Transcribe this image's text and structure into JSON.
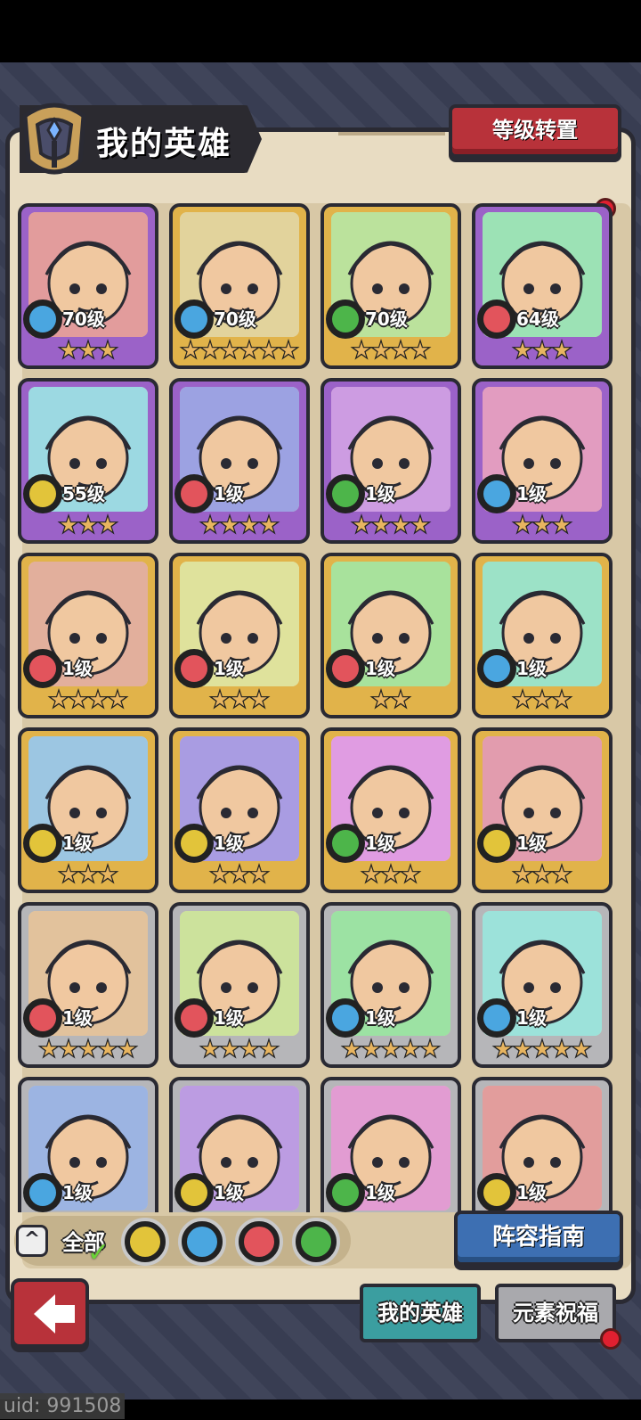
{
  "header": {
    "title": "我的英雄",
    "level_transfer_label": "等级转置"
  },
  "colors": {
    "water": "#4aa6e0",
    "fire": "#e2545c",
    "wind": "#4db54a",
    "earth": "#e2c43a",
    "card_purple": "#9b62c8",
    "card_gold": "#e1b34a",
    "card_silver": "#b6b6b9"
  },
  "heroes": [
    {
      "level": "70级",
      "element": "water",
      "frame": "purple",
      "stars": 3
    },
    {
      "level": "70级",
      "element": "water",
      "frame": "gold",
      "stars": 6
    },
    {
      "level": "70级",
      "element": "wind",
      "frame": "gold",
      "stars": 4
    },
    {
      "level": "64级",
      "element": "fire",
      "frame": "purple",
      "stars": 3
    },
    {
      "level": "55级",
      "element": "earth",
      "frame": "purple",
      "stars": 3
    },
    {
      "level": "1级",
      "element": "fire",
      "frame": "purple",
      "stars": 4
    },
    {
      "level": "1级",
      "element": "wind",
      "frame": "purple",
      "stars": 4
    },
    {
      "level": "1级",
      "element": "water",
      "frame": "purple",
      "stars": 3
    },
    {
      "level": "1级",
      "element": "fire",
      "frame": "gold",
      "stars": 4
    },
    {
      "level": "1级",
      "element": "fire",
      "frame": "gold",
      "stars": 3
    },
    {
      "level": "1级",
      "element": "fire",
      "frame": "gold",
      "stars": 2
    },
    {
      "level": "1级",
      "element": "water",
      "frame": "gold",
      "stars": 3
    },
    {
      "level": "1级",
      "element": "earth",
      "frame": "gold",
      "stars": 3
    },
    {
      "level": "1级",
      "element": "earth",
      "frame": "gold",
      "stars": 3
    },
    {
      "level": "1级",
      "element": "wind",
      "frame": "gold",
      "stars": 3
    },
    {
      "level": "1级",
      "element": "earth",
      "frame": "gold",
      "stars": 3
    },
    {
      "level": "1级",
      "element": "fire",
      "frame": "silver",
      "stars": 5
    },
    {
      "level": "1级",
      "element": "fire",
      "frame": "silver",
      "stars": 4
    },
    {
      "level": "1级",
      "element": "water",
      "frame": "silver",
      "stars": 5
    },
    {
      "level": "1级",
      "element": "water",
      "frame": "silver",
      "stars": 5
    },
    {
      "level": "1级",
      "element": "water",
      "frame": "silver",
      "stars": 0
    },
    {
      "level": "1级",
      "element": "earth",
      "frame": "silver",
      "stars": 0
    },
    {
      "level": "1级",
      "element": "wind",
      "frame": "silver",
      "stars": 0
    },
    {
      "level": "1级",
      "element": "earth",
      "frame": "silver",
      "stars": 0
    }
  ],
  "filters": {
    "all_label": "全部",
    "elements": [
      "earth",
      "water",
      "fire",
      "wind"
    ]
  },
  "lineup_guide_label": "阵容指南",
  "tabs": [
    {
      "label": "我的英雄",
      "active": true
    },
    {
      "label": "元素祝福",
      "active": false
    }
  ],
  "uid_text": "uid: 991508"
}
